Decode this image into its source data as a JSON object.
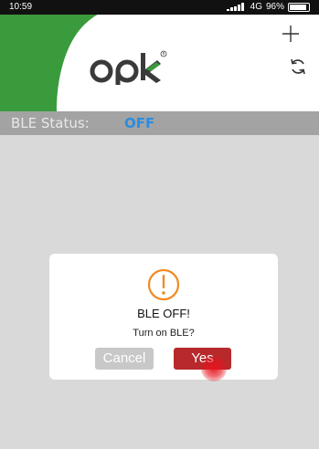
{
  "statusbar": {
    "time": "10:59",
    "network": "4G",
    "battery": "96%"
  },
  "header": {
    "logo_text": "opk",
    "plus_icon": "plus-icon",
    "refresh_icon": "refresh-icon",
    "brand_green": "#3a9b3c"
  },
  "ble": {
    "label": "BLE Status:",
    "value": "OFF",
    "value_color": "#2b8de0"
  },
  "dialog": {
    "icon": "warning-icon",
    "icon_color": "#f08a24",
    "title": "BLE OFF!",
    "message": "Turn on BLE?",
    "cancel_label": "Cancel",
    "yes_label": "Yes",
    "yes_color": "#b8292b"
  }
}
